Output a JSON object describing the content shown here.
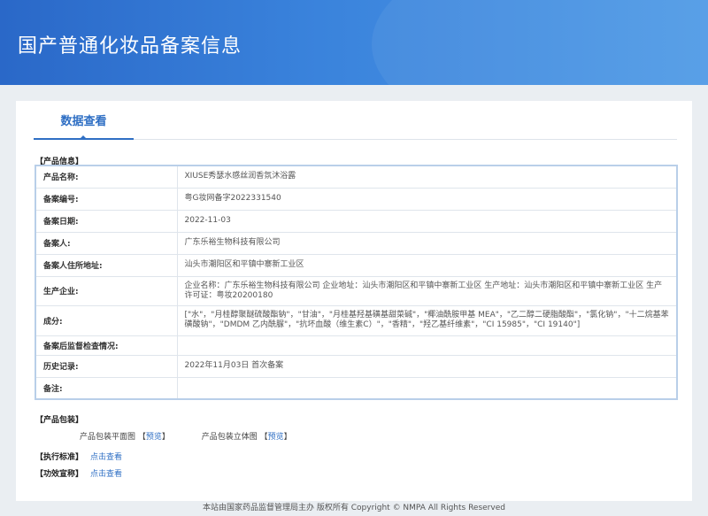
{
  "header": {
    "title": "国产普通化妆品备案信息"
  },
  "tabs": {
    "active": "数据查看"
  },
  "product_info": {
    "section_title": "【产品信息】",
    "rows": [
      {
        "label": "产品名称:",
        "value": "XIUSE秀瑟水感丝润香氛沐浴露"
      },
      {
        "label": "备案编号:",
        "value": "粤G妆网备字2022331540"
      },
      {
        "label": "备案日期:",
        "value": "2022-11-03"
      },
      {
        "label": "备案人:",
        "value": "广东乐裕生物科技有限公司"
      },
      {
        "label": "备案人住所地址:",
        "value": "汕头市潮阳区和平镇中寨新工业区"
      },
      {
        "label": "生产企业:",
        "value": "企业名称：广东乐裕生物科技有限公司 企业地址：汕头市潮阳区和平镇中寨新工业区 生产地址：汕头市潮阳区和平镇中寨新工业区 生产许可证：粤妆20200180"
      },
      {
        "label": "成分:",
        "value": "[\"水\"，\"月桂醇聚醚硫酸酯钠\"，\"甘油\"，\"月桂基羟基磺基甜菜碱\"，\"椰油酰胺甲基 MEA\"，\"乙二醇二硬脂酸酯\"，\"氯化钠\"，\"十二烷基苯磺酸钠\"，\"DMDM 乙内酰脲\"，\"抗坏血酸（维生素C）\"，\"香精\"，\"羟乙基纤维素\"，\"CI 15985\"，\"CI 19140\"]"
      },
      {
        "label": "备案后监督检查情况:",
        "value": ""
      },
      {
        "label": "历史记录:",
        "value": "2022年11月03日 首次备案"
      },
      {
        "label": "备注:",
        "value": ""
      }
    ]
  },
  "packaging": {
    "section_title": "【产品包装】",
    "flat_label": "产品包装平面图",
    "solid_label": "产品包装立体图",
    "preview_link": "预览",
    "bracket_open": "【",
    "bracket_close": "】"
  },
  "standard": {
    "label": "【执行标准】",
    "link": "点击查看"
  },
  "efficacy": {
    "label": "【功效宣称】",
    "link": "点击查看"
  },
  "footer": {
    "text": "本站由国家药品监督管理局主办 版权所有 Copyright © NMPA All Rights Reserved"
  },
  "colors": {
    "header_start": "#2a68c8",
    "header_end": "#4f9ae6",
    "accent": "#2f6fc4",
    "table_border": "#b9cfe9"
  }
}
